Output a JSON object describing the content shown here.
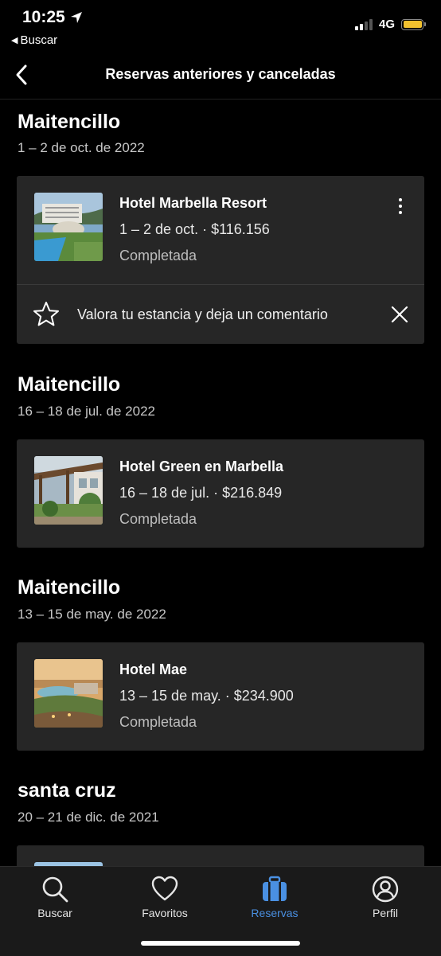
{
  "status_bar": {
    "time": "10:25",
    "back_app": "Buscar",
    "network": "4G"
  },
  "nav": {
    "title": "Reservas anteriores y canceladas"
  },
  "bookings": [
    {
      "location": "Maitencillo",
      "dates": "1 – 2 de oct. de 2022",
      "hotel": "Hotel Marbella Resort",
      "info": "1 – 2 de oct. · $116.156",
      "status": "Completada",
      "review_prompt": "Valora tu estancia y deja un comentario"
    },
    {
      "location": "Maitencillo",
      "dates": "16 – 18 de jul. de 2022",
      "hotel": "Hotel Green en Marbella",
      "info": "16 – 18 de jul. · $216.849",
      "status": "Completada"
    },
    {
      "location": "Maitencillo",
      "dates": "13 – 15 de may. de 2022",
      "hotel": "Hotel Mae",
      "info": "13 – 15 de may. · $234.900",
      "status": "Completada"
    },
    {
      "location": "santa cruz",
      "dates": "20 – 21 de dic. de 2021"
    }
  ],
  "tabs": [
    {
      "label": "Buscar",
      "icon": "search-icon",
      "active": false
    },
    {
      "label": "Favoritos",
      "icon": "heart-icon",
      "active": false
    },
    {
      "label": "Reservas",
      "icon": "suitcase-icon",
      "active": true
    },
    {
      "label": "Perfil",
      "icon": "profile-icon",
      "active": false
    }
  ],
  "colors": {
    "background": "#000000",
    "card": "#262626",
    "accent": "#4a90e2",
    "battery": "#f2c12e"
  }
}
